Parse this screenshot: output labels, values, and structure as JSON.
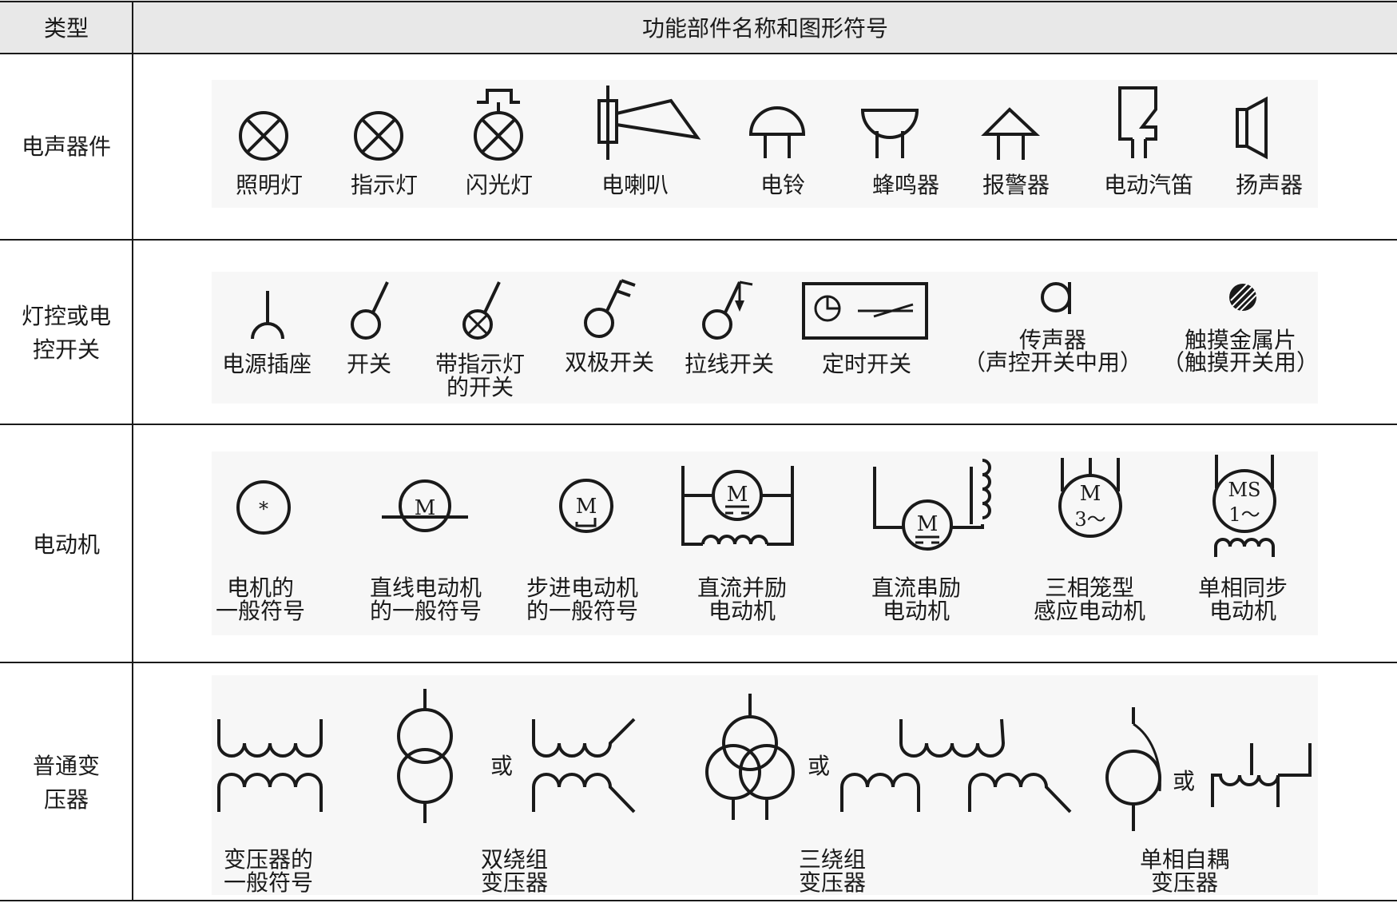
{
  "table": {
    "header": {
      "col_type": "类型",
      "col_items": "功能部件名称和图形符号"
    },
    "rows": [
      {
        "type": "电声器件",
        "items": [
          {
            "label": "照明灯",
            "icon": "lamp-icon"
          },
          {
            "label": "指示灯",
            "icon": "indicator-lamp-icon"
          },
          {
            "label": "闪光灯",
            "icon": "flash-lamp-icon"
          },
          {
            "label": "电喇叭",
            "icon": "horn-icon"
          },
          {
            "label": "电铃",
            "icon": "bell-icon"
          },
          {
            "label": "蜂鸣器",
            "icon": "buzzer-icon"
          },
          {
            "label": "报警器",
            "icon": "siren-icon"
          },
          {
            "label": "电动汽笛",
            "icon": "electric-whistle-icon"
          },
          {
            "label": "扬声器",
            "icon": "loudspeaker-icon"
          }
        ]
      },
      {
        "type_line1": "灯控或电",
        "type_line2": "控开关",
        "items": [
          {
            "label": "电源插座",
            "icon": "socket-icon"
          },
          {
            "label": "开关",
            "icon": "switch-icon"
          },
          {
            "label_line1": "带指示灯",
            "label_line2": "的开关",
            "icon": "switch-with-lamp-icon"
          },
          {
            "label": "双极开关",
            "icon": "double-pole-switch-icon"
          },
          {
            "label": "拉线开关",
            "icon": "pull-cord-switch-icon"
          },
          {
            "label": "定时开关",
            "icon": "timer-switch-icon"
          },
          {
            "label_line1": "传声器",
            "label_line2": "（声控开关中用）",
            "icon": "microphone-icon"
          },
          {
            "label_line1": "触摸金属片",
            "label_line2": "（触摸开关用）",
            "icon": "touch-plate-icon"
          }
        ]
      },
      {
        "type": "电动机",
        "items": [
          {
            "label_line1": "电机的",
            "label_line2": "一般符号",
            "icon": "motor-general-icon",
            "symbol": "*"
          },
          {
            "label_line1": "直线电动机",
            "label_line2": "的一般符号",
            "icon": "linear-motor-icon",
            "symbol": "M"
          },
          {
            "label_line1": "步进电动机",
            "label_line2": "的一般符号",
            "icon": "stepper-motor-icon",
            "symbol": "M"
          },
          {
            "label_line1": "直流并励",
            "label_line2": "电动机",
            "icon": "dc-shunt-motor-icon",
            "symbol": "M"
          },
          {
            "label_line1": "直流串励",
            "label_line2": "电动机",
            "icon": "dc-series-motor-icon",
            "symbol": "M"
          },
          {
            "label_line1": "三相笼型",
            "label_line2": "感应电动机",
            "icon": "three-phase-motor-icon",
            "symbol": "M",
            "symbol2": "3～"
          },
          {
            "label_line1": "单相同步",
            "label_line2": "电动机",
            "icon": "single-phase-sync-motor-icon",
            "symbol": "MS",
            "symbol2": "1～"
          }
        ]
      },
      {
        "type_line1": "普通变",
        "type_line2": "压器",
        "or_text": "或",
        "items": [
          {
            "label_line1": "变压器的",
            "label_line2": "一般符号",
            "icon": "transformer-general-icon"
          },
          {
            "label_line1": "双绕组",
            "label_line2": "变压器",
            "icon": "two-winding-transformer-icon"
          },
          {
            "label_line1": "三绕组",
            "label_line2": "变压器",
            "icon": "three-winding-transformer-icon"
          },
          {
            "label_line1": "单相自耦",
            "label_line2": "变压器",
            "icon": "autotransformer-icon"
          }
        ]
      }
    ]
  },
  "colors": {
    "line": "#1a1a1a",
    "header_bg": "#e8e8e8",
    "panel_bg": "#f7f7f7"
  }
}
